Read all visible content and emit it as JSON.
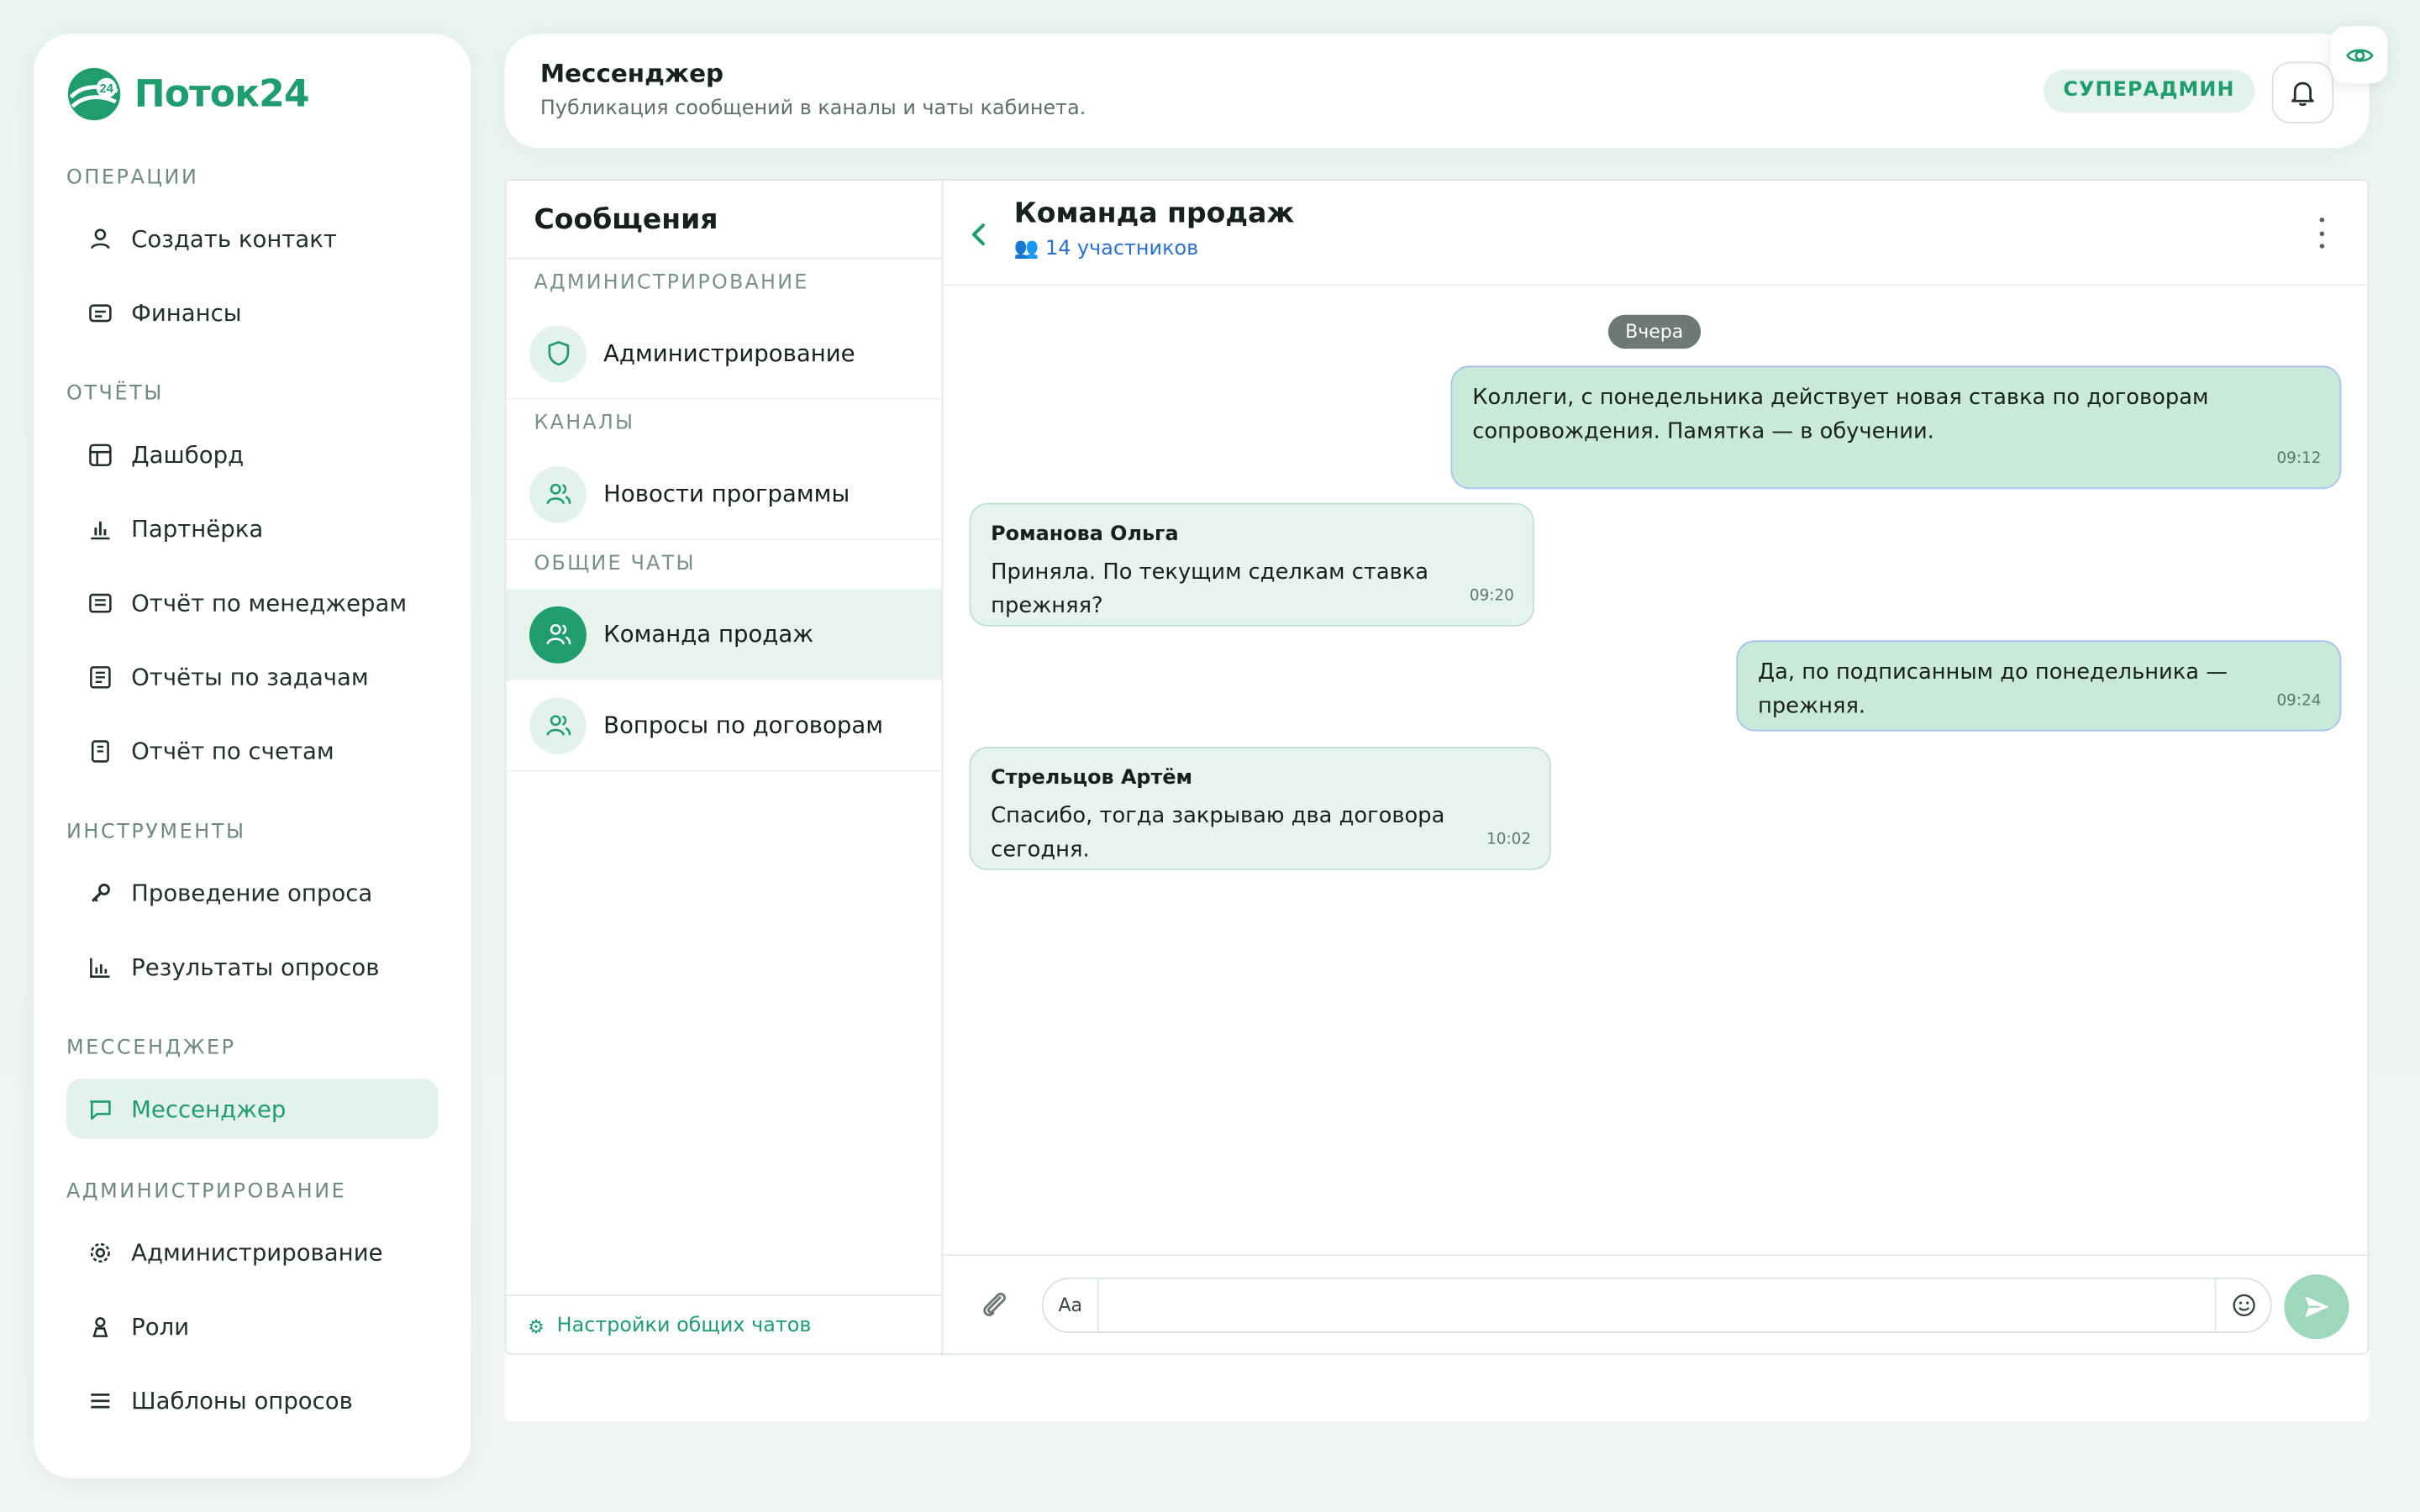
{
  "app": {
    "logo_text": "Поток24",
    "logo_badge": "24",
    "brand_color": "#1f9d6e"
  },
  "sidebar": {
    "sections": [
      {
        "title": "ОПЕРАЦИИ",
        "items": [
          {
            "label": "Создать контакт",
            "icon": "user-icon"
          },
          {
            "label": "Финансы",
            "icon": "wallet-icon"
          }
        ]
      },
      {
        "title": "ОТЧЁТЫ",
        "items": [
          {
            "label": "Дашборд",
            "icon": "table-icon"
          },
          {
            "label": "Партнёрка",
            "icon": "bar-chart-icon"
          },
          {
            "label": "Отчёт по менеджерам",
            "icon": "report-icon"
          },
          {
            "label": "Отчёты по задачам",
            "icon": "tasks-report-icon"
          },
          {
            "label": "Отчёт по счетам",
            "icon": "receipt-icon"
          }
        ]
      },
      {
        "title": "ИНСТРУМЕНТЫ",
        "items": [
          {
            "label": "Проведение опроса",
            "icon": "key-icon"
          },
          {
            "label": "Результаты опросов",
            "icon": "chart-icon"
          }
        ]
      },
      {
        "title": "МЕССЕНДЖЕР",
        "items": [
          {
            "label": "Мессенджер",
            "icon": "chat-icon",
            "active": true
          }
        ]
      },
      {
        "title": "АДМИНИСТРИРОВАНИЕ",
        "items": [
          {
            "label": "Администрирование",
            "icon": "gear-icon"
          },
          {
            "label": "Роли",
            "icon": "person-icon"
          },
          {
            "label": "Шаблоны опросов",
            "icon": "list-icon"
          }
        ]
      }
    ]
  },
  "header": {
    "title": "Мессенджер",
    "subtitle": "Публикация сообщений в каналы и чаты кабинета.",
    "role_badge": "СУПЕРАДМИН"
  },
  "chat_list": {
    "title": "Сообщения",
    "groups": [
      {
        "title": "АДМИНИСТРИРОВАНИЕ",
        "chats": [
          {
            "name": "Администрирование",
            "icon": "shield-icon"
          }
        ]
      },
      {
        "title": "КАНАЛЫ",
        "chats": [
          {
            "name": "Новости программы",
            "icon": "users-icon"
          }
        ]
      },
      {
        "title": "ОБЩИЕ ЧАТЫ",
        "chats": [
          {
            "name": "Команда продаж",
            "icon": "users-icon",
            "active": true
          },
          {
            "name": "Вопросы по договорам",
            "icon": "users-icon"
          }
        ]
      }
    ],
    "footer_label": "Настройки общих чатов",
    "footer_icon": "⚙"
  },
  "chat": {
    "title": "Команда продаж",
    "members": "👥 14 участников",
    "day_label": "Вчера",
    "messages": [
      {
        "direction": "out",
        "author": "",
        "text": "Коллеги, с понедельника действует новая ставка по договорам сопровождения. Памятка — в обучении.",
        "time": "09:12"
      },
      {
        "direction": "in",
        "author": "Романова Ольга",
        "text": "Приняла. По текущим сделкам ставка прежняя?",
        "time": "09:20"
      },
      {
        "direction": "out",
        "author": "",
        "text": "Да, по подписанным до понедельника — прежняя.",
        "time": "09:24"
      },
      {
        "direction": "in",
        "author": "Стрельцов Артём",
        "text": "Спасибо, тогда закрываю два договора сегодня.",
        "time": "10:02"
      }
    ],
    "composer": {
      "format_label": "Aa",
      "placeholder": ""
    }
  }
}
